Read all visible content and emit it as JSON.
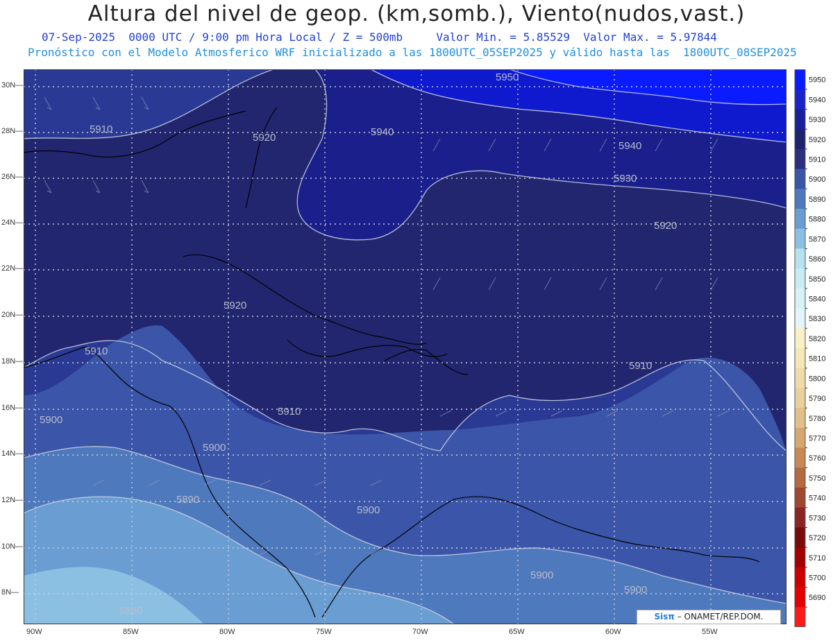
{
  "header": {
    "title": "Altura del nivel de geop. (km,somb.), Viento(nudos,vast.)",
    "line1": "07-Sep-2025  0000 UTC / 9:00 pm Hora Local / Z = 500mb     Valor Min. = 5.85529  Valor Max. = 5.97844",
    "line2": "Pronóstico con el Modelo Atmosferico WRF inicializado a las 1800UTC_05SEP2025 y válido hasta las  1800UTC_08SEP2025"
  },
  "axes": {
    "lon_labels": [
      "90W",
      "85W",
      "80W",
      "75W",
      "70W",
      "65W",
      "60W",
      "55W"
    ],
    "lat_labels": [
      "30N",
      "28N",
      "26N",
      "24N",
      "22N",
      "20N",
      "18N",
      "16N",
      "14N",
      "12N",
      "10N",
      "8N"
    ]
  },
  "contour_labels": [
    "5950",
    "5940",
    "5940",
    "5930",
    "5920",
    "5920",
    "5920",
    "5910",
    "5910",
    "5910",
    "5910",
    "5900",
    "5900",
    "5900",
    "5900",
    "5900",
    "5890",
    "5880"
  ],
  "colorbar": {
    "levels": [
      "5950",
      "5940",
      "5930",
      "5920",
      "5910",
      "5900",
      "5890",
      "5880",
      "5870",
      "5860",
      "5850",
      "5840",
      "5830",
      "5820",
      "5810",
      "5800",
      "5790",
      "5780",
      "5770",
      "5760",
      "5750",
      "5740",
      "5730",
      "5720",
      "5710",
      "5700",
      "5690"
    ],
    "colors": [
      "#0a1bff",
      "#1a23cc",
      "#18209a",
      "#1e2370",
      "#2a2f80",
      "#3b55a8",
      "#4f79bd",
      "#6a9dd1",
      "#8cc0e2",
      "#b8e2ef",
      "#c9ecf2",
      "#d7f1f6",
      "#e3f5f8",
      "#f8f1c8",
      "#f5e7b6",
      "#efdcaa",
      "#e9d09c",
      "#e2c08a",
      "#d6a770",
      "#c78a54",
      "#b46b40",
      "#9e4830",
      "#8c2424",
      "#7b0a0a",
      "#a30000",
      "#cc0000",
      "#e60000",
      "#ff1a1a"
    ]
  },
  "credit": {
    "logo": "Sisπ",
    "text": " – ONAMET/REP.DOM."
  }
}
